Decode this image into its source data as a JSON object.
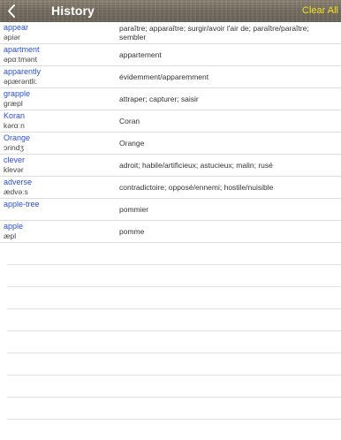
{
  "header": {
    "title": "History",
    "clear_label": "Clear All",
    "back_icon": "chevron-left-icon"
  },
  "entries": [
    {
      "word": "appear",
      "pron": "əpiər",
      "translation": "paraître; apparaître; surgir/avoir l'air de; paraître/paraître; sembler"
    },
    {
      "word": "apartment",
      "pron": "əpαːtmənt",
      "translation": "appartement"
    },
    {
      "word": "apparently",
      "pron": "əpærəntli:",
      "translation": "évidemment/apparemment"
    },
    {
      "word": "grapple",
      "pron": "græpl",
      "translation": "attraper; capturer; saisir"
    },
    {
      "word": "Koran",
      "pron": "kərαːn",
      "translation": "Coran"
    },
    {
      "word": "Orange",
      "pron": "ɔrindʒ",
      "translation": "Orange"
    },
    {
      "word": "clever",
      "pron": "klevər",
      "translation": "adroit; habile/artificieux; astucieux; malin; rusé"
    },
    {
      "word": "adverse",
      "pron": "ædvəːs",
      "translation": "contradictoire; opposé/ennemi; hostile/nuisible"
    },
    {
      "word": "apple-tree",
      "pron": "",
      "translation": "pommier"
    },
    {
      "word": "apple",
      "pron": "æpl",
      "translation": "pomme"
    }
  ],
  "colors": {
    "word": "#2a4fd6",
    "clear_all": "#f2e21a",
    "header_title": "#ffffff"
  }
}
